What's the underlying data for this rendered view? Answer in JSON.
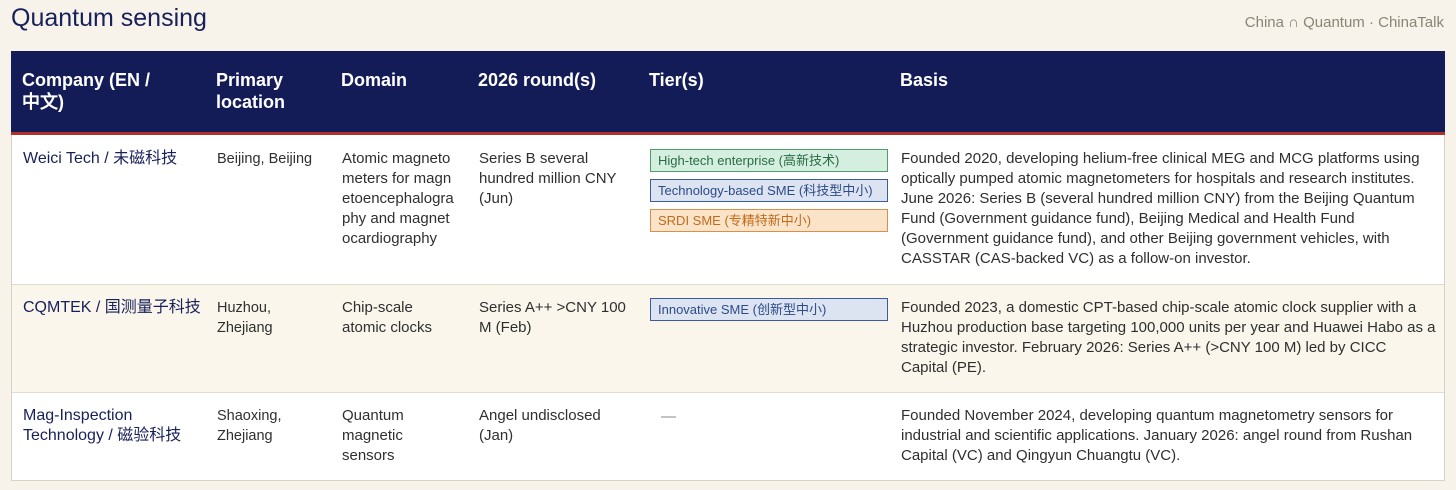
{
  "page": {
    "title": "Quantum sensing",
    "source": "China ∩ Quantum · ChinaTalk"
  },
  "table": {
    "headers": {
      "company": "Company (EN / 中文)",
      "location": "Primary location",
      "domain": "Domain",
      "rounds": "2026 round(s)",
      "tiers": "Tier(s)",
      "basis": "Basis"
    },
    "rows": [
      {
        "company": "Weici Tech / 未磁科技",
        "location": "Beijing, Beijing",
        "domain": "Atomic magnetometers for magnetoencephalography and magnetocardiography",
        "round": "Series B several hundred million CNY (Jun)",
        "tiers": [
          {
            "label": "High-tech enterprise (高新技术)",
            "color": "green"
          },
          {
            "label": "Technology-based SME (科技型中小)",
            "color": "blue"
          },
          {
            "label": "SRDI SME (专精特新中小)",
            "color": "orange"
          }
        ],
        "basis": "Founded 2020, developing helium-free clinical MEG and MCG platforms using optically pumped atomic magnetometers for hospitals and research institutes. June 2026: Series B (several hundred million CNY) from the Beijing Quantum Fund (Government guidance fund), Beijing Medical and Health Fund (Government guidance fund), and other Beijing government vehicles, with CASSTAR (CAS-backed VC) as a follow-on investor."
      },
      {
        "company": "CQMTEK / 国测量子科技",
        "location": "Huzhou, Zhejiang",
        "domain": "Chip-scale atomic clocks",
        "round": "Series A++ >CNY 100 M (Feb)",
        "tiers": [
          {
            "label": "Innovative SME (创新型中小)",
            "color": "blue"
          }
        ],
        "basis": "Founded 2023, a domestic CPT-based chip-scale atomic clock supplier with a Huzhou production base targeting 100,000 units per year and Huawei Habo as a strategic investor. February 2026: Series A++ (>CNY 100 M) led by CICC Capital (PE)."
      },
      {
        "company": "Mag-Inspection Technology / 磁验科技",
        "location": "Shaoxing, Zhejiang",
        "domain": "Quantum magnetic sensors",
        "round": "Angel undisclosed (Jan)",
        "tiers_empty": "—",
        "basis": "Founded November 2024, developing quantum magnetometry sensors for industrial and scientific applications. January 2026: angel round from Rushan Capital (VC) and Qingyun Chuangtu (VC)."
      }
    ]
  },
  "colors": {
    "header_bg": "#141c58",
    "header_rule": "#b0302c",
    "title": "#18205a"
  }
}
